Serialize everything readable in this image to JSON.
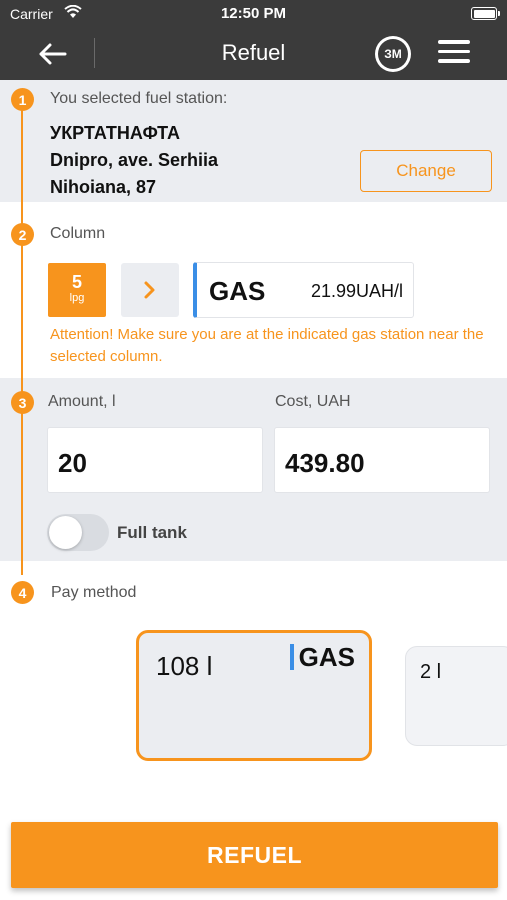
{
  "status_bar": {
    "carrier": "Carrier",
    "time": "12:50 PM"
  },
  "header": {
    "title": "Refuel",
    "avatar_initials": "ЗМ"
  },
  "steps": [
    "1",
    "2",
    "3",
    "4"
  ],
  "station": {
    "label": "You selected fuel station:",
    "name_line1": "УКРТАТНАФТА",
    "name_line2": "Dnipro, ave. Serhiia",
    "name_line3": "Nihoiana, 87",
    "change_label": "Change"
  },
  "column": {
    "label": "Column",
    "number": "5",
    "sub": "lpg",
    "fuel_name": "GAS",
    "price": "21.99UAH/l",
    "attention": "Attention! Make sure you are at the indicated gas station near the selected column."
  },
  "amount": {
    "amount_label": "Amount, l",
    "amount_value": "20",
    "cost_label": "Cost, UAH",
    "cost_value": "439.80",
    "full_tank_label": "Full tank",
    "full_tank_on": false
  },
  "pay": {
    "label": "Pay method",
    "cards": [
      {
        "amount": "108 l",
        "brand": "GAS",
        "selected": true
      },
      {
        "amount": "2 l",
        "brand": "",
        "selected": false
      }
    ]
  },
  "refuel_button": "REFUEL",
  "colors": {
    "accent": "#f7941d",
    "header_bg": "#3b3b3b",
    "section_bg": "#ebedf1",
    "brand_bar": "#3a8ee6"
  }
}
